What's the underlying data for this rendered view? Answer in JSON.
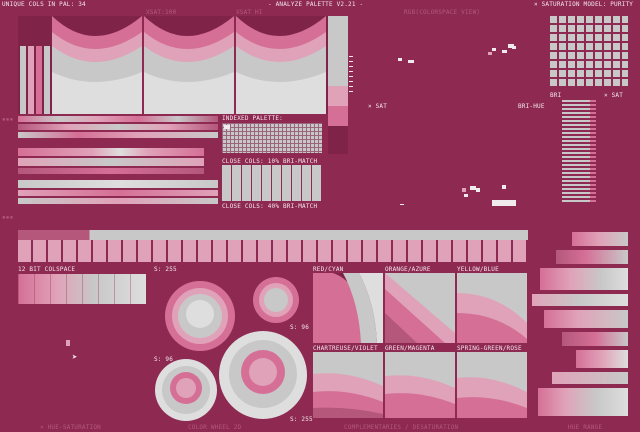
{
  "header": {
    "unique_cols": "UNIQUE COLS IN PAL: 34",
    "title": "- ANALYZE PALETTE V2.21 -",
    "saturation_model": "× SATURATION MODEL: PURITY",
    "sub_left": "",
    "sub_xsat": "XSAT:100",
    "sub_mid": "XSAT HI",
    "sub_right": "RGB(COLORSPACE VIEW)"
  },
  "labels": {
    "indexed_palette": "INDEXED PALETTE:",
    "close_cols_1": "CLOSE COLS: 10% BRI-MATCH",
    "close_cols_2": "CLOSE COLS: 40% BRI-MATCH",
    "sat_marker": "× SAT",
    "bri_hue": "BRI-HUE",
    "bri": "BRI",
    "sat_right": "× SAT",
    "colspace_12bit": "12 BIT COLSPACE",
    "s255_top": "S: 255",
    "s96_top": "S: 96",
    "s96_bottom": "S: 96",
    "s255_bottom": "S: 255",
    "red_cyan": "RED/CYAN",
    "orange_azure": "ORANGE/AZURE",
    "yellow_blue": "YELLOW/BLUE",
    "chartreuse_violet": "CHARTREUSE/VIOLET",
    "green_magenta": "GREEN/MAGENTA",
    "spring_rose": "SPRING-GREEN/ROSE"
  },
  "footer": {
    "left": "× HUE-SATURATION",
    "mid": "COLOR WHEEL 2D",
    "complementaries": "COMPLEMENTARIES / DESATURATION",
    "right": "HUE RANGE"
  },
  "colors": {
    "bg": "#8e2a52",
    "dark": "#7f2348",
    "mid": "#b4577b",
    "pink": "#d56f96",
    "light": "#e0a2b8",
    "grey": "#c8c8c8",
    "white": "#f0eaec"
  }
}
